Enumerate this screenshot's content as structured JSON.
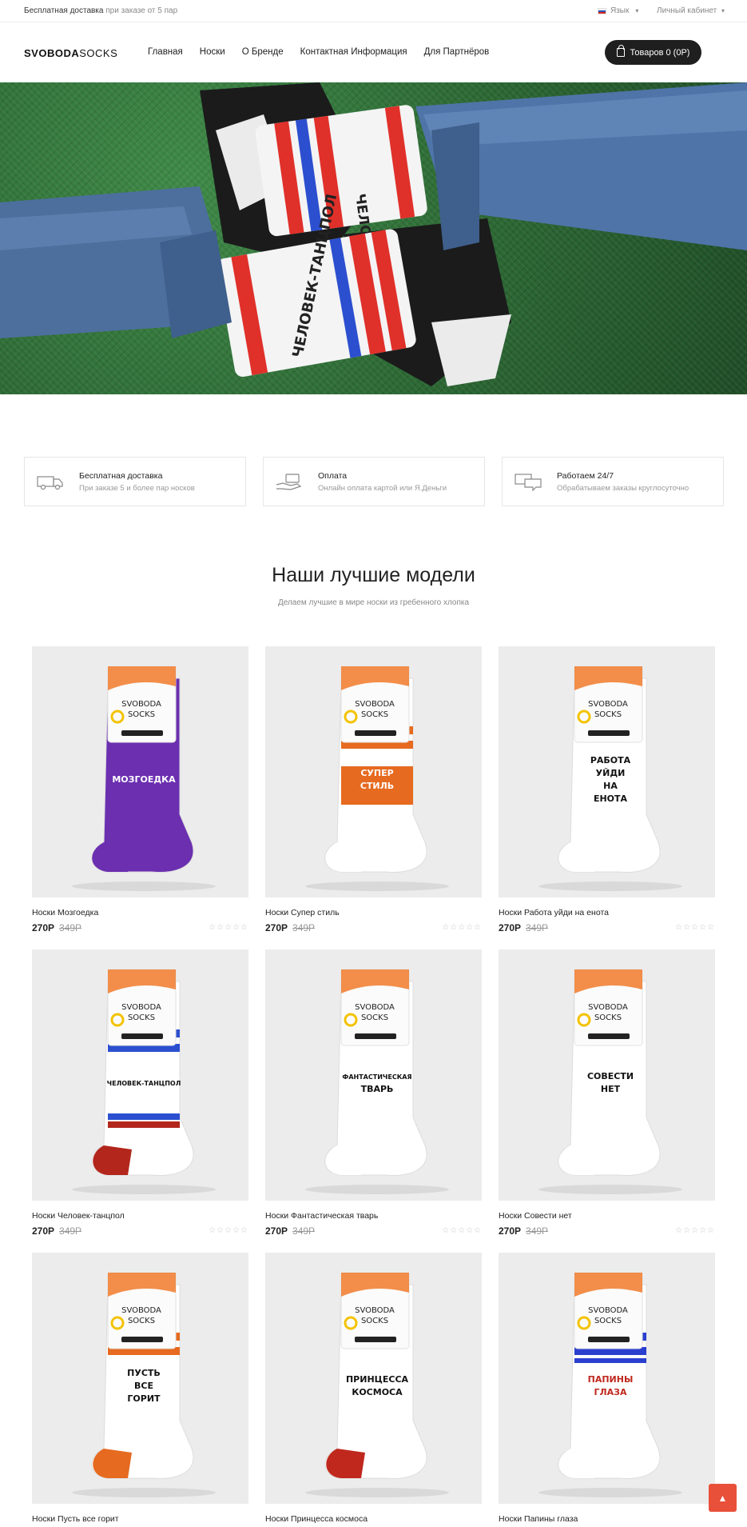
{
  "topbar": {
    "promo_main": "Бесплатная доставка",
    "promo_rest": "при заказе от 5 пар",
    "language": "Язык",
    "account": "Личный кабинет"
  },
  "header": {
    "logo_bold": "SVOBODA",
    "logo_light": "SOCKS",
    "nav": [
      "Главная",
      "Носки",
      "О Бренде",
      "Контактная Информация",
      "Для Партнёров"
    ],
    "cart_label": "Товаров 0 (0Р)"
  },
  "hero": {
    "sock_text_1": "ЧЕЛОВЕК-ТАНЦПОЛ",
    "sock_text_2": "ЧЕЛОВЕК-ТАНЦПОЛ"
  },
  "features": [
    {
      "icon": "truck-icon",
      "title": "Бесплатная доставка",
      "subtitle": "При заказе 5 и более пар носков"
    },
    {
      "icon": "hand-card-icon",
      "title": "Оплата",
      "subtitle": "Онлайн оплата картой или Я.Деньги"
    },
    {
      "icon": "chat-icon",
      "title": "Работаем 24/7",
      "subtitle": "Обрабатываем заказы круглосуточно"
    }
  ],
  "section": {
    "title": "Наши лучшие модели",
    "subtitle": "Делаем лучшие в мире носки из гребенного хлопка"
  },
  "products": [
    {
      "name": "Носки Мозгоедка",
      "price": "270Р",
      "old_price": "349Р",
      "print": "МОЗГОЕДКА",
      "color": "#6b2fb0",
      "stripe": "#ffffff",
      "heel": "#6b2fb0"
    },
    {
      "name": "Носки Супер стиль",
      "price": "270Р",
      "old_price": "349Р",
      "print": "СУПЕР СТИЛЬ",
      "color": "#ffffff",
      "stripe": "#e66a1f",
      "heel": "#ffffff"
    },
    {
      "name": "Носки Работа уйди на енота",
      "price": "270Р",
      "old_price": "349Р",
      "print": "РАБОТА УЙДИ НА ЕНОТА",
      "color": "#ffffff",
      "stripe": "#ffffff",
      "heel": "#ffffff"
    },
    {
      "name": "Носки Человек-танцпол",
      "price": "270Р",
      "old_price": "349Р",
      "print": "ЧЕЛОВЕК-ТАНЦПОЛ",
      "color": "#ffffff",
      "stripe": "#2b4fcf",
      "heel": "#b2261c"
    },
    {
      "name": "Носки Фантастическая тварь",
      "price": "270Р",
      "old_price": "349Р",
      "print": "ФАНТАСТИЧЕСКАЯ ТВАРЬ",
      "color": "#ffffff",
      "stripe": "#ffffff",
      "heel": "#ffffff"
    },
    {
      "name": "Носки Совести нет",
      "price": "270Р",
      "old_price": "349Р",
      "print": "СОВЕСТИ НЕТ",
      "color": "#ffffff",
      "stripe": "#ffffff",
      "heel": "#ffffff"
    },
    {
      "name": "Носки Пусть все горит",
      "price": "",
      "old_price": "",
      "print": "ПУСТЬ ВСЕ ГОРИТ",
      "color": "#ffffff",
      "stripe": "#e66a1f",
      "heel": "#e66a1f"
    },
    {
      "name": "Носки Принцесса космоса",
      "price": "",
      "old_price": "",
      "print": "ПРИНЦЕССА КОСМОСА",
      "color": "#ffffff",
      "stripe": "#ffffff",
      "heel": "#c0281e"
    },
    {
      "name": "Носки Папины глаза",
      "price": "",
      "old_price": "",
      "print": "ПАПИНЫ ГЛАЗА",
      "color": "#ffffff",
      "stripe": "#2b3fcf",
      "heel": "#ffffff"
    }
  ],
  "label": {
    "brand_1": "SVOBODA",
    "brand_2": "SOCKS"
  },
  "stars": "☆☆☆☆☆",
  "scroll_top": "▲"
}
